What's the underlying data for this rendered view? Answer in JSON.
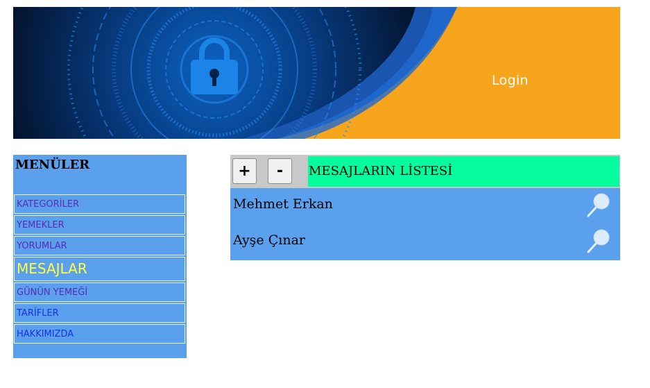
{
  "banner": {
    "login_label": "Login",
    "colors": {
      "orange": "#f7a51c",
      "dark_navy": "#041a3a",
      "blue_glow": "#1a78d6"
    },
    "icon": "padlock-icon"
  },
  "sidebar": {
    "title": "MENÜLER",
    "items": [
      {
        "label": "KATEGORİLER",
        "state": "normal"
      },
      {
        "label": "YEMEKLER",
        "state": "normal"
      },
      {
        "label": "YORUMLAR",
        "state": "normal"
      },
      {
        "label": "MESAJLAR",
        "state": "active"
      },
      {
        "label": "GÜNÜN YEMEĞİ",
        "state": "normal"
      },
      {
        "label": "TARİFLER",
        "state": "plain"
      },
      {
        "label": "HAKKIMIZDA",
        "state": "plain"
      }
    ],
    "colors": {
      "background": "#5ba0ec",
      "active_text": "#ffff3d",
      "item_text": "#5a2bb8",
      "link_text": "#1a2fe8"
    }
  },
  "messages": {
    "plus_label": "+",
    "minus_label": "-",
    "title": "MESAJLARIN LİSTESİ",
    "rows": [
      {
        "name": "Mehmet Erkan",
        "icon": "search-icon"
      },
      {
        "name": "Ayşe Çınar",
        "icon": "search-icon"
      }
    ],
    "colors": {
      "title_bg": "#05fd9e",
      "body_bg": "#5ba0ec"
    }
  }
}
